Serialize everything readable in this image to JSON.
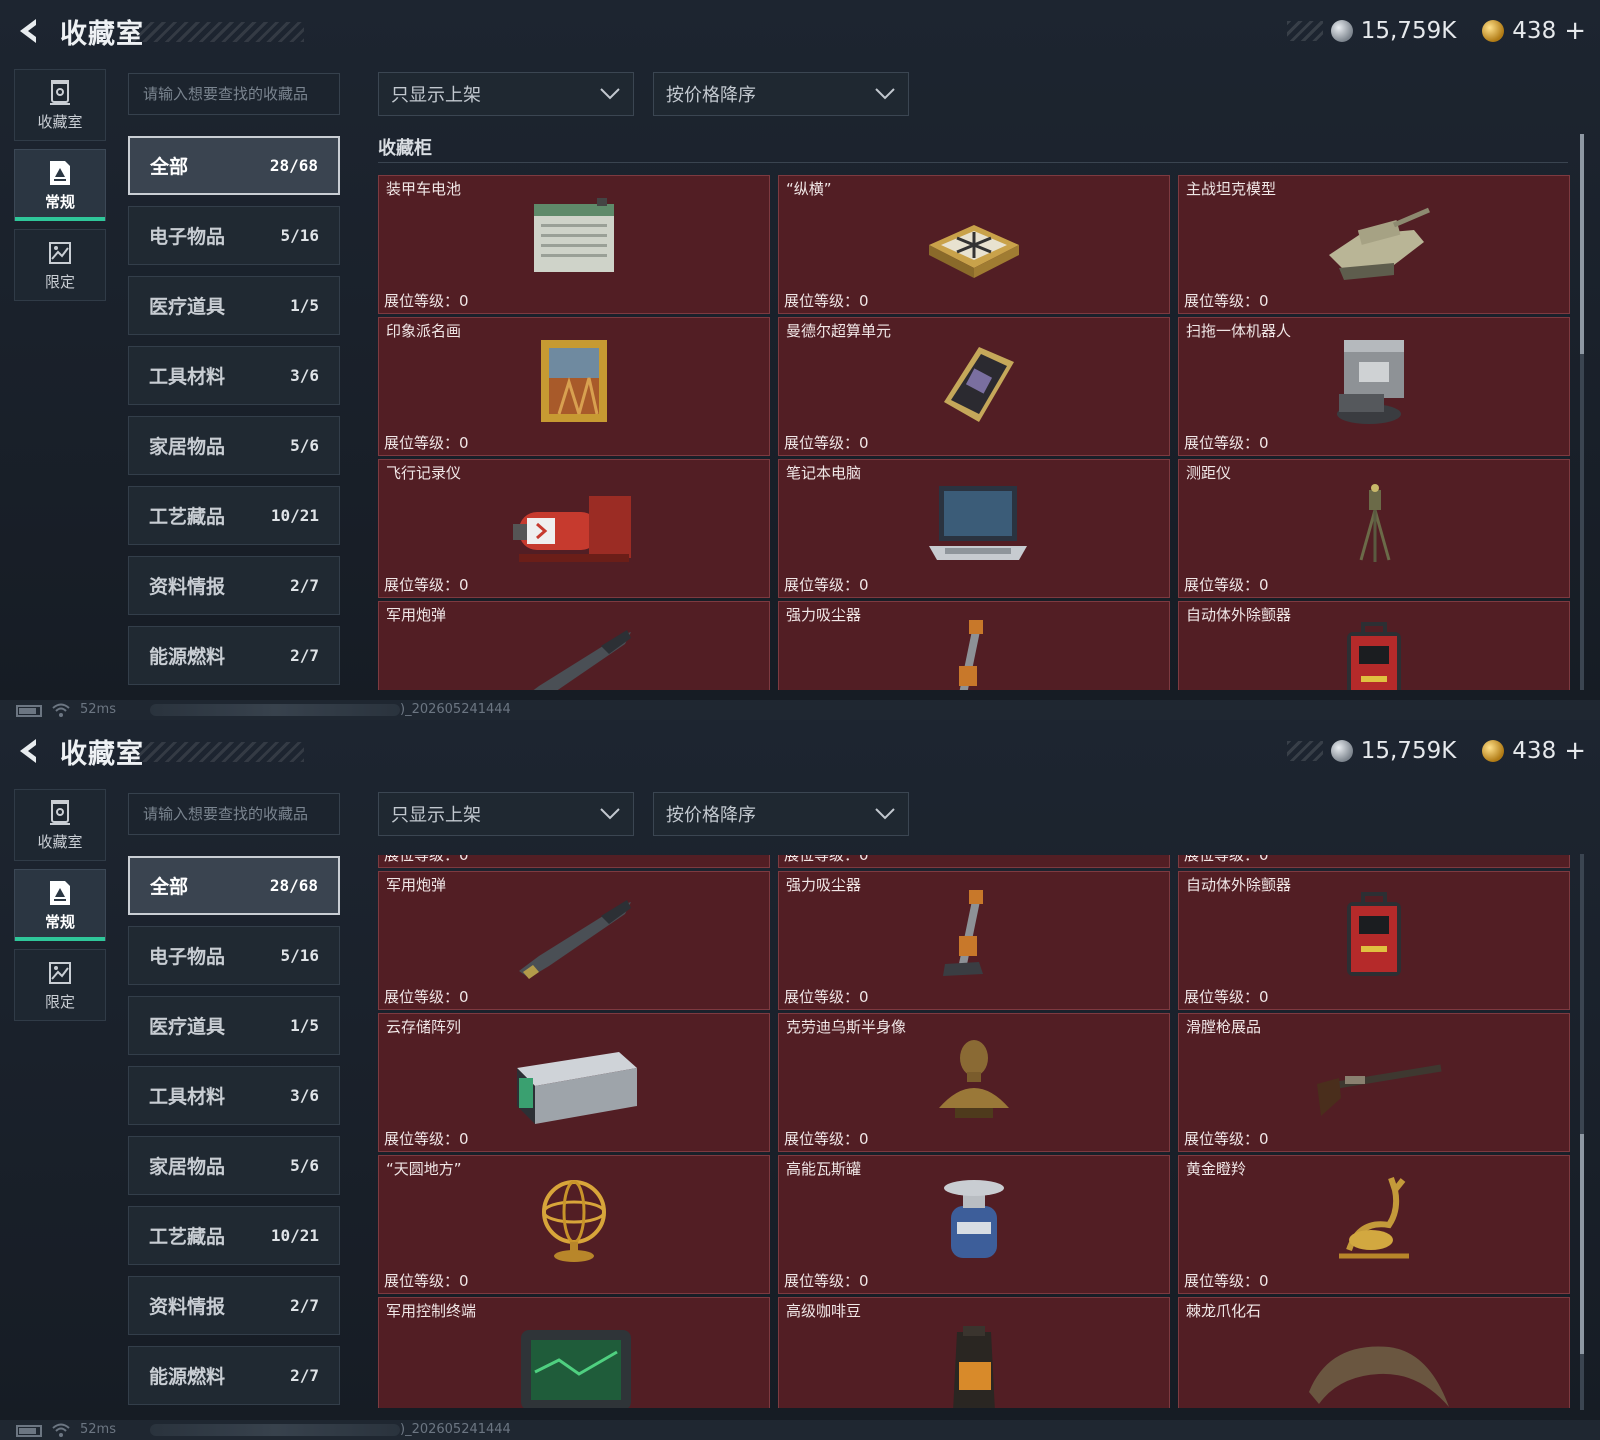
{
  "header": {
    "title": "收藏室"
  },
  "currency": {
    "silver": "15,759K",
    "gold": "438",
    "add_symbol": "+"
  },
  "rail": [
    {
      "label": "收藏室",
      "icon": "collection-room-icon",
      "active": false
    },
    {
      "label": "常规",
      "icon": "regular-document-icon",
      "active": true
    },
    {
      "label": "限定",
      "icon": "limited-image-icon",
      "active": false
    }
  ],
  "search": {
    "placeholder": "请输入想要查找的收藏品"
  },
  "filters": {
    "listing": "只显示上架",
    "sort": "按价格降序"
  },
  "categories": [
    {
      "label": "全部",
      "count": "28/68",
      "active": true
    },
    {
      "label": "电子物品",
      "count": "5/16"
    },
    {
      "label": "医疗道具",
      "count": "1/5"
    },
    {
      "label": "工具材料",
      "count": "3/6"
    },
    {
      "label": "家居物品",
      "count": "5/6"
    },
    {
      "label": "工艺藏品",
      "count": "10/21"
    },
    {
      "label": "资料情报",
      "count": "2/7"
    },
    {
      "label": "能源燃料",
      "count": "2/7"
    }
  ],
  "cabinet": {
    "title": "收藏柜",
    "level_text": "展位等级：0",
    "items": [
      {
        "name": "装甲车电池",
        "art": "battery-art"
      },
      {
        "name": "“纵横”",
        "art": "chessboard-art"
      },
      {
        "name": "主战坦克模型",
        "art": "tank-art"
      },
      {
        "name": "印象派名画",
        "art": "painting-art"
      },
      {
        "name": "曼德尔超算单元",
        "art": "supercomputer-art"
      },
      {
        "name": "扫拖一体机器人",
        "art": "robot-vacuum-art"
      },
      {
        "name": "飞行记录仪",
        "art": "flight-recorder-art"
      },
      {
        "name": "笔记本电脑",
        "art": "laptop-art"
      },
      {
        "name": "测距仪",
        "art": "rangefinder-art"
      },
      {
        "name": "军用炮弹",
        "art": "shell-art"
      },
      {
        "name": "强力吸尘器",
        "art": "vacuum-art"
      },
      {
        "name": "自动体外除颤器",
        "art": "defibrillator-art"
      },
      {
        "name": "云存储阵列",
        "art": "storage-array-art"
      },
      {
        "name": "克劳迪乌斯半身像",
        "art": "bust-art"
      },
      {
        "name": "滑膛枪展品",
        "art": "musket-art"
      },
      {
        "name": "“天圆地方”",
        "art": "armillary-art"
      },
      {
        "name": "高能瓦斯罐",
        "art": "gas-tank-art"
      },
      {
        "name": "黄金瞪羚",
        "art": "gazelle-art"
      },
      {
        "name": "军用控制终端",
        "art": "terminal-art"
      },
      {
        "name": "高级咖啡豆",
        "art": "coffee-art"
      },
      {
        "name": "棘龙爪化石",
        "art": "claw-fossil-art"
      }
    ]
  },
  "status": {
    "ping": "52ms",
    "build": ")_202605241444"
  },
  "colors": {
    "card_bg": "#521e24",
    "accent_green": "#2fc79a"
  }
}
